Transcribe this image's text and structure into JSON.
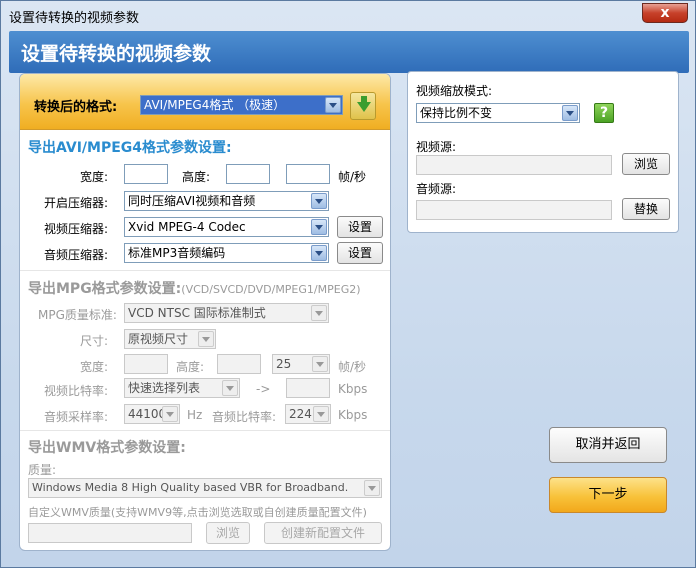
{
  "window": {
    "title": "设置待转换的视频参数",
    "close": "x"
  },
  "banner": {
    "title": "设置待转换的视频参数"
  },
  "format": {
    "label": "转换后的格式:",
    "value": "AVI/MPEG4格式            （极速）"
  },
  "avi": {
    "title": "导出AVI/MPEG4格式参数设置:",
    "width_label": "宽度:",
    "height_label": "高度:",
    "fps_label": "帧/秒",
    "compressor_label": "开启压缩器:",
    "compressor_value": "同时压缩AVI视频和音频",
    "video_compressor_label": "视频压缩器:",
    "video_compressor_value": "Xvid MPEG-4 Codec",
    "audio_compressor_label": "音频压缩器:",
    "audio_compressor_value": "标准MP3音频编码",
    "settings_label": "设置"
  },
  "mpg": {
    "title": "导出MPG格式参数设置:",
    "subtitle": "(VCD/SVCD/DVD/MPEG1/MPEG2)",
    "quality_label": "MPG质量标准:",
    "quality_value": "VCD  NTSC 国际标准制式",
    "size_label": "尺寸:",
    "size_value": "原视频尺寸",
    "width_label": "宽度:",
    "height_label": "高度:",
    "fps_value": "25",
    "fps_label": "帧/秒",
    "video_bitrate_label": "视频比特率:",
    "video_bitrate_value": "快速选择列表",
    "arrow": "->",
    "kbps1": "Kbps",
    "sample_rate_label": "音频采样率:",
    "sample_rate_value": "44100",
    "hz": "Hz",
    "audio_bitrate_label": "音频比特率:",
    "audio_bitrate_value": "224",
    "kbps2": "Kbps"
  },
  "wmv": {
    "title": "导出WMV格式参数设置:",
    "quality_label": "质量:",
    "quality_value": "Windows Media 8 High Quality based VBR for Broadband.",
    "custom_label": "自定义WMV质量(支持WMV9等,点击浏览选取或自创建质量配置文件)",
    "browse_label": "浏览",
    "create_label": "创建新配置文件"
  },
  "right": {
    "scale_label": "视频缩放模式:",
    "scale_value": "保持比例不变",
    "help": "?",
    "video_src_label": "视频源:",
    "browse_label": "浏览",
    "audio_src_label": "音频源:",
    "replace_label": "替换"
  },
  "actions": {
    "cancel": "取消并返回",
    "next": "下一步"
  }
}
